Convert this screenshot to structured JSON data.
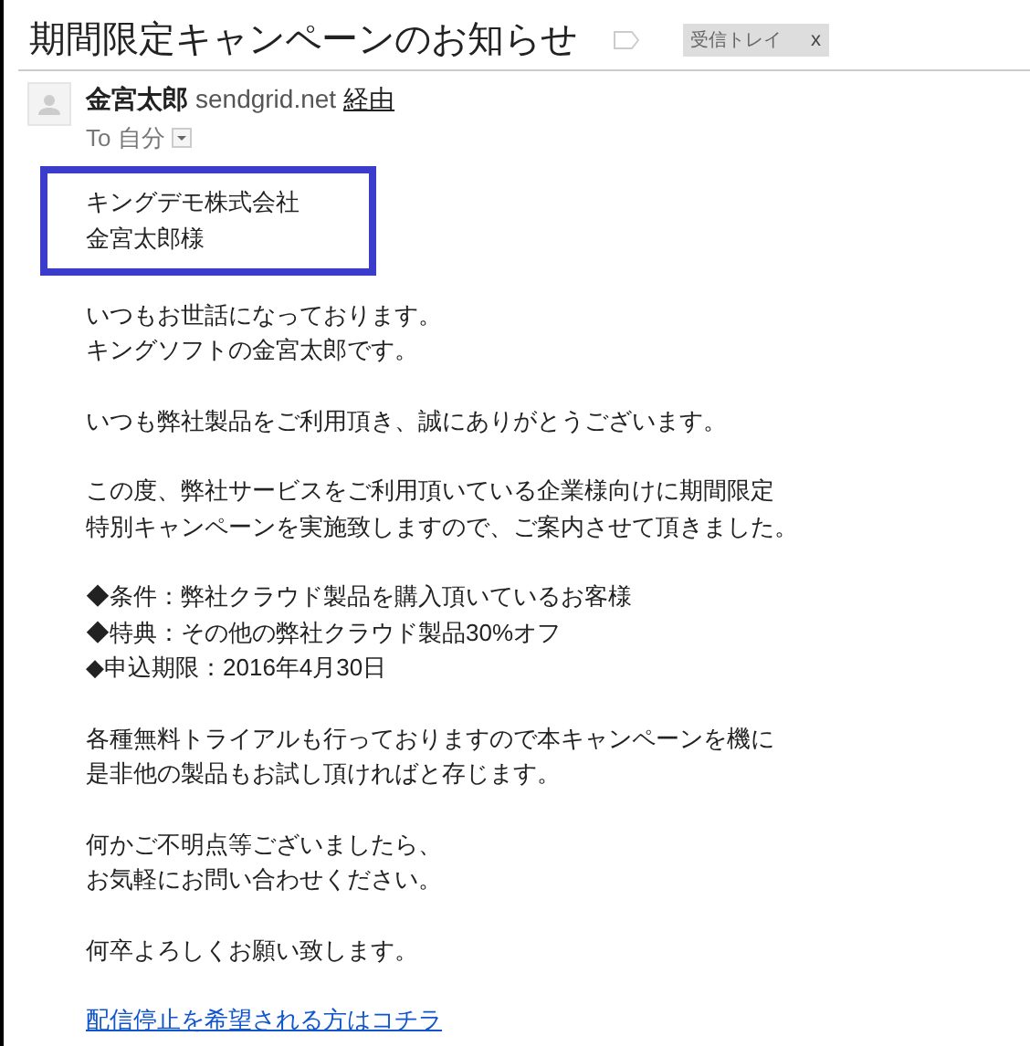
{
  "subject": "期間限定キャンペーンのお知らせ",
  "label_chip": {
    "text": "受信トレイ",
    "close": "x"
  },
  "sender": {
    "name": "金宮太郎",
    "domain": "sendgrid.net",
    "via": "経由"
  },
  "recipient": "To 自分",
  "address_block": [
    "キングデモ株式会社",
    "金宮太郎様"
  ],
  "paragraphs": [
    [
      "いつもお世話になっております。",
      "キングソフトの金宮太郎です。"
    ],
    [
      "いつも弊社製品をご利用頂き、誠にありがとうございます。"
    ],
    [
      "この度、弊社サービスをご利用頂いている企業様向けに期間限定",
      "特別キャンペーンを実施致しますので、ご案内させて頂きました。"
    ],
    [
      "◆条件：弊社クラウド製品を購入頂いているお客様",
      "◆特典：その他の弊社クラウド製品30%オフ",
      "◆申込期限：2016年4月30日"
    ],
    [
      "各種無料トライアルも行っておりますので本キャンペーンを機に",
      "是非他の製品もお試し頂ければと存じます。"
    ],
    [
      "何かご不明点等ございましたら、",
      "お気軽にお問い合わせください。"
    ],
    [
      "何卒よろしくお願い致します。"
    ]
  ],
  "unsubscribe_link": "配信停止を希望される方はコチラ"
}
